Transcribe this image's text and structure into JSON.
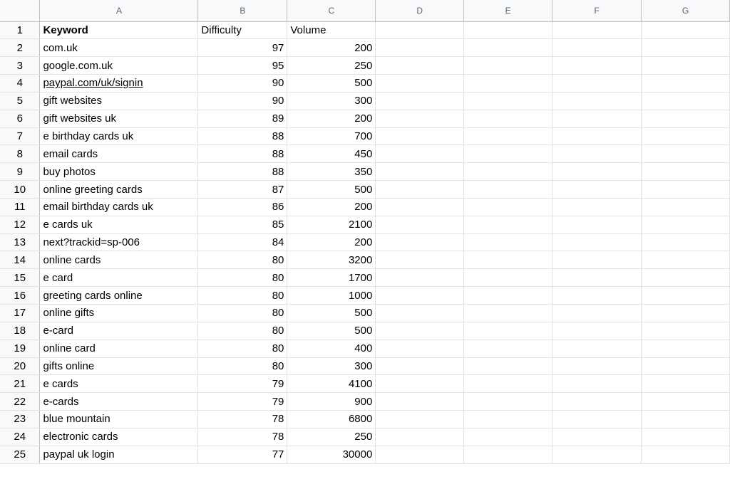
{
  "sheet": {
    "column_headers": [
      "A",
      "B",
      "C",
      "D",
      "E",
      "F",
      "G"
    ],
    "header_row": {
      "row_number": "1",
      "keyword": "Keyword",
      "difficulty": "Difficulty",
      "volume": "Volume"
    },
    "rows": [
      {
        "row_number": "2",
        "keyword": "com.uk",
        "difficulty": "97",
        "volume": "200"
      },
      {
        "row_number": "3",
        "keyword": "google.com.uk",
        "difficulty": "95",
        "volume": "250"
      },
      {
        "row_number": "4",
        "keyword": "paypal.com/uk/signin",
        "difficulty": "90",
        "volume": "500"
      },
      {
        "row_number": "5",
        "keyword": "gift websites",
        "difficulty": "90",
        "volume": "300"
      },
      {
        "row_number": "6",
        "keyword": "gift websites uk",
        "difficulty": "89",
        "volume": "200"
      },
      {
        "row_number": "7",
        "keyword": "e birthday cards uk",
        "difficulty": "88",
        "volume": "700"
      },
      {
        "row_number": "8",
        "keyword": "email cards",
        "difficulty": "88",
        "volume": "450"
      },
      {
        "row_number": "9",
        "keyword": "buy photos",
        "difficulty": "88",
        "volume": "350"
      },
      {
        "row_number": "10",
        "keyword": "online greeting cards",
        "difficulty": "87",
        "volume": "500"
      },
      {
        "row_number": "11",
        "keyword": "email birthday cards uk",
        "difficulty": "86",
        "volume": "200"
      },
      {
        "row_number": "12",
        "keyword": "e cards uk",
        "difficulty": "85",
        "volume": "2100"
      },
      {
        "row_number": "13",
        "keyword": "next?trackid=sp-006",
        "difficulty": "84",
        "volume": "200"
      },
      {
        "row_number": "14",
        "keyword": "online cards",
        "difficulty": "80",
        "volume": "3200"
      },
      {
        "row_number": "15",
        "keyword": "e card",
        "difficulty": "80",
        "volume": "1700"
      },
      {
        "row_number": "16",
        "keyword": "greeting cards online",
        "difficulty": "80",
        "volume": "1000"
      },
      {
        "row_number": "17",
        "keyword": "online gifts",
        "difficulty": "80",
        "volume": "500"
      },
      {
        "row_number": "18",
        "keyword": "e-card",
        "difficulty": "80",
        "volume": "500"
      },
      {
        "row_number": "19",
        "keyword": "online card",
        "difficulty": "80",
        "volume": "400"
      },
      {
        "row_number": "20",
        "keyword": "gifts online",
        "difficulty": "80",
        "volume": "300"
      },
      {
        "row_number": "21",
        "keyword": "e cards",
        "difficulty": "79",
        "volume": "4100"
      },
      {
        "row_number": "22",
        "keyword": "e-cards",
        "difficulty": "79",
        "volume": "900"
      },
      {
        "row_number": "23",
        "keyword": "blue mountain",
        "difficulty": "78",
        "volume": "6800"
      },
      {
        "row_number": "24",
        "keyword": "electronic cards",
        "difficulty": "78",
        "volume": "250"
      },
      {
        "row_number": "25",
        "keyword": "paypal uk login",
        "difficulty": "77",
        "volume": "30000"
      }
    ]
  },
  "colors": {
    "header_bg": "#f8f9fa",
    "gridline": "#e2e2e2",
    "link": "#1155cc"
  }
}
